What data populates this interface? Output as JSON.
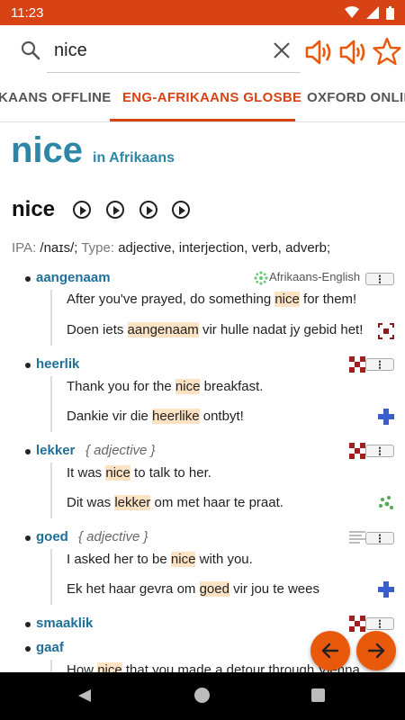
{
  "status": {
    "time": "11:23"
  },
  "search": {
    "query": "nice"
  },
  "tabs": [
    "KAANS OFFLINE",
    "ENG-AFRIKAANS GLOSBE",
    "OXFORD ONLIN"
  ],
  "header": {
    "word": "nice",
    "lang": "in Afrikaans",
    "headword": "nice"
  },
  "ipa": {
    "ipa_label": "IPA:",
    "ipa_value": "/naɪs/;",
    "type_label": "Type:",
    "type_value": "adjective, interjection, verb, adverb;"
  },
  "entries": [
    {
      "term": "aangenaam",
      "pos": "",
      "source": "Afrikaans-English",
      "ex_en": [
        "After you've prayed, do something ",
        "nice",
        " for them!"
      ],
      "ex_af": [
        "Doen iets ",
        "aangenaam",
        " vir hulle nadat jy gebid het!"
      ]
    },
    {
      "term": "heerlik",
      "pos": "",
      "ex_en": [
        "Thank you for the ",
        "nice",
        " breakfast."
      ],
      "ex_af": [
        "Dankie vir die ",
        "heerlike",
        " ontbyt!"
      ]
    },
    {
      "term": "lekker",
      "pos": "{ adjective }",
      "ex_en": [
        "It was ",
        "nice",
        " to talk to her."
      ],
      "ex_af": [
        "Dit was ",
        "lekker",
        " om met haar te praat."
      ]
    },
    {
      "term": "goed",
      "pos": "{ adjective }",
      "ex_en": [
        "I asked her to be ",
        "nice",
        " with you."
      ],
      "ex_af": [
        "Ek het haar gevra om ",
        "goed",
        " vir jou te wees"
      ]
    },
    {
      "term": "smaaklik"
    },
    {
      "term": "gaaf",
      "ex_en": [
        "How ",
        "nice",
        " that you made a detour through Vienna"
      ]
    }
  ],
  "colors": {
    "accent": "#d84315",
    "link": "#1e6f9a",
    "title": "#2e86a6",
    "highlight": "#fde2c4"
  },
  "icons": [
    "search-icon",
    "clear-icon",
    "speaker-icon",
    "star-icon",
    "play-icon",
    "menu-icon",
    "arrow-left-icon",
    "arrow-right-icon",
    "nav-back-icon",
    "nav-home-icon",
    "nav-recents-icon"
  ]
}
